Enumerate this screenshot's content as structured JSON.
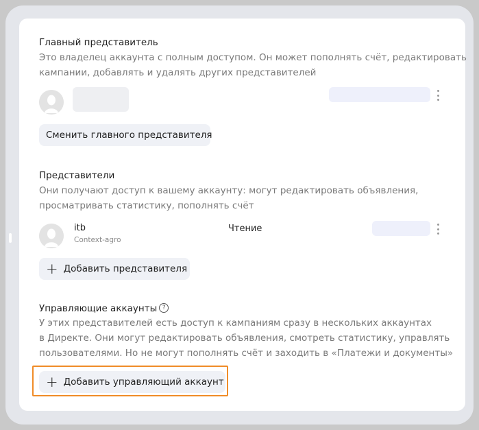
{
  "main_representative": {
    "title": "Главный представитель",
    "desc_line1": "Это владелец аккаунта с полным доступом. Он может пополнять счёт, редактировать",
    "desc_line2": "кампании, добавлять и удалять других представителей",
    "change_button": "Сменить главного представителя"
  },
  "representatives": {
    "title": "Представители",
    "desc_line1": "Они получают доступ к вашему аккаунту: могут редактировать объявления,",
    "desc_line2": "просматривать статистику, пополнять счёт",
    "items": [
      {
        "login": "itb",
        "client": "Context-agro",
        "role": "Чтение"
      }
    ],
    "add_button": "Добавить представителя"
  },
  "managing_accounts": {
    "title": "Управляющие аккаунты",
    "help_symbol": "?",
    "desc_line1": "У этих представителей есть доступ к кампаниям сразу в нескольких аккаунтах",
    "desc_line2": "в Директе. Они могут редактировать объявления, смотреть статистику, управлять",
    "desc_line3": "пользователями. Но не могут пополнять счёт и заходить в «Платежи и документы»",
    "add_button": "Добавить управляющий аккаунт"
  },
  "icons": {
    "avatar": "user-avatar-icon",
    "more": "kebab-menu-icon",
    "plus": "plus-icon",
    "help": "help-circle-icon"
  },
  "colors": {
    "highlight": "#f08c28",
    "button_bg": "#eff1f6",
    "text_secondary": "#7a7a7a"
  }
}
